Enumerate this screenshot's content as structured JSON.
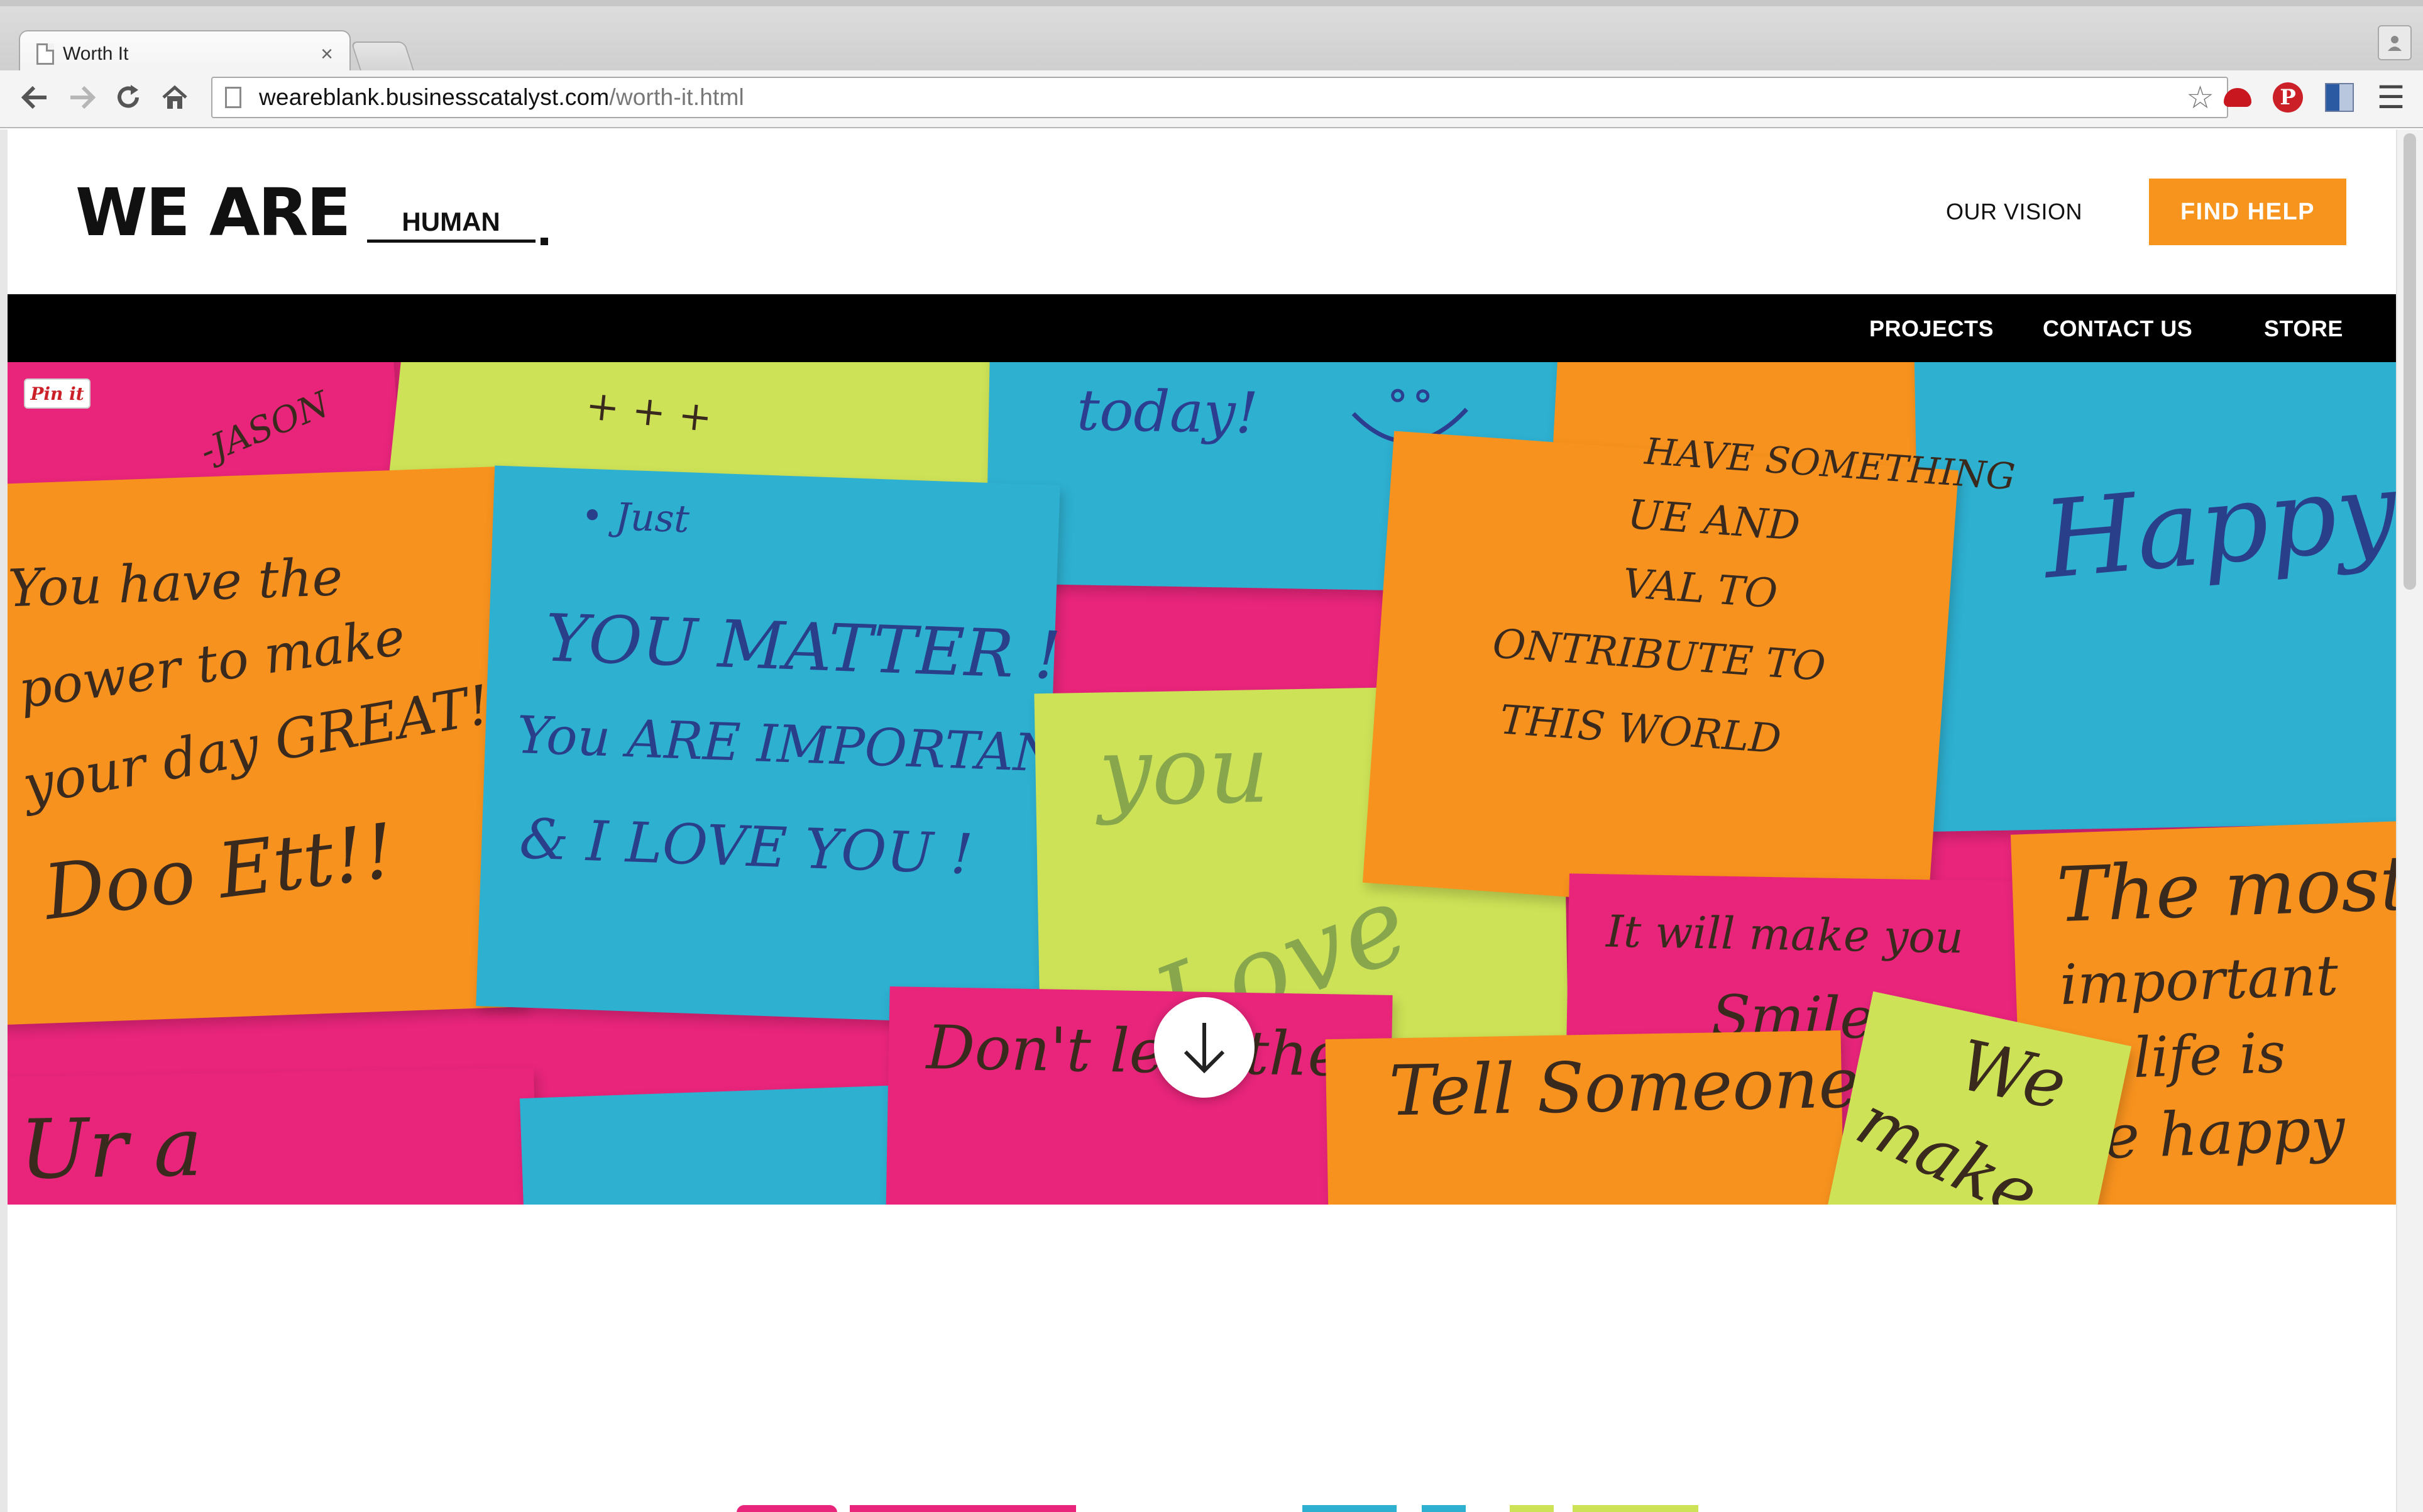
{
  "browser": {
    "tab_title": "Worth It",
    "tab_close": "×",
    "url_host": "weareblank.businesscatalyst.com",
    "url_path": "/worth-it.html",
    "icons": [
      "back-icon",
      "forward-icon",
      "reload-icon",
      "home-icon",
      "bookmark-star-icon",
      "menu-icon"
    ]
  },
  "header": {
    "logo_main": "WE ARE",
    "logo_word": "HUMAN",
    "vision_link": "OUR VISION",
    "find_help_button": "FIND HELP"
  },
  "nav": {
    "items": [
      "PROJECTS",
      "CONTACT US",
      "STORE"
    ]
  },
  "hero": {
    "pin_it": "Pin it",
    "notes": {
      "jason": "-JASON",
      "power": [
        "You have the",
        "power to make",
        "your day GREAT!",
        "Doo Ett!!"
      ],
      "matter": [
        "YOU MATTER !",
        "You ARE IMPORTANT !",
        "& I LOVE YOU !"
      ],
      "today": "today!",
      "smile_face": "◡ ̈",
      "just": "• Just",
      "you_love": [
        "you",
        "Love"
      ],
      "contribute": [
        "HAVE SOMETHING",
        "UE AND",
        "VAL TO",
        "ONTRIBUTE TO",
        "THIS WORLD"
      ],
      "happy": "Happy!",
      "smile": [
        "It will make you",
        "Smile"
      ],
      "most_important": [
        "The most",
        "important",
        "in life is",
        "be happy"
      ],
      "tell": "Tell Someone",
      "dont": "Don't let other",
      "we_make": [
        "We",
        "make"
      ],
      "ura": "Ur a",
      "plus_marks": "+ + +"
    }
  },
  "colors": {
    "accent": "#f7941d",
    "nav_bg": "#000000",
    "note_pink": "#e8257b",
    "note_orange": "#f7921e",
    "note_blue": "#2eb0d1",
    "note_lime": "#cde257"
  }
}
